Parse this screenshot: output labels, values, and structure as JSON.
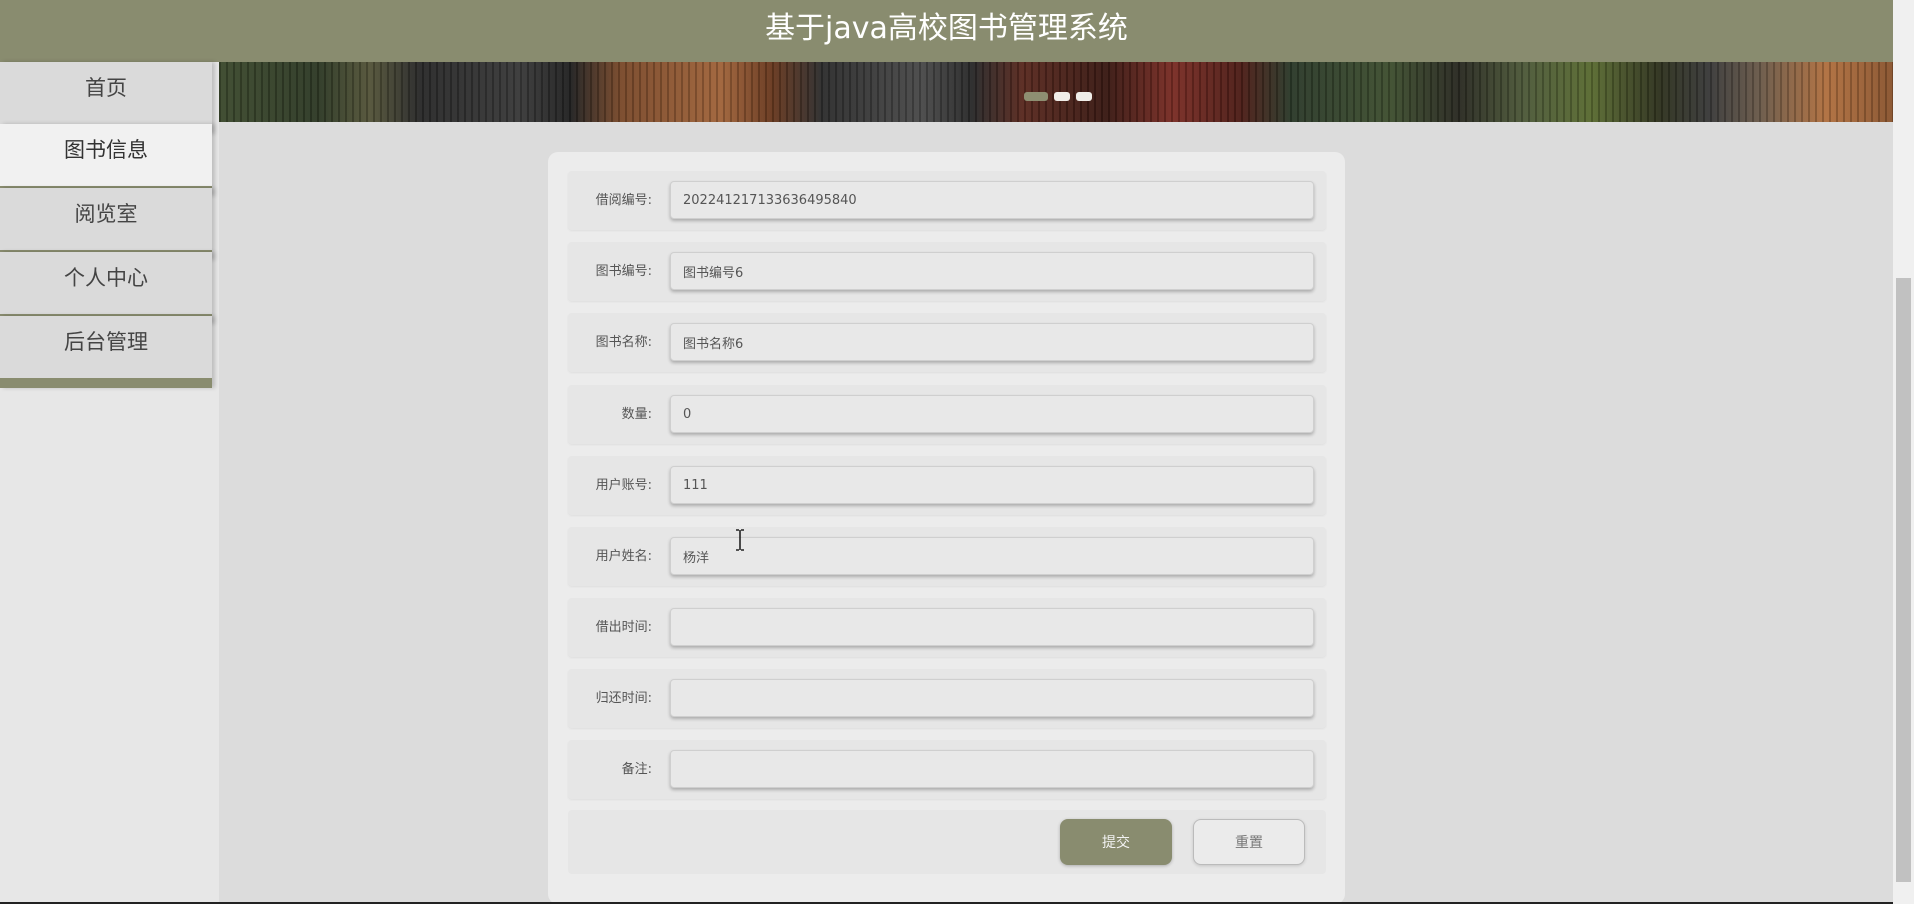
{
  "header": {
    "title": "基于java高校图书管理系统"
  },
  "nav": {
    "items": [
      {
        "label": "首页",
        "active": false
      },
      {
        "label": "图书信息",
        "active": true
      },
      {
        "label": "阅览室",
        "active": false
      },
      {
        "label": "个人中心",
        "active": false
      },
      {
        "label": "后台管理",
        "active": false
      }
    ]
  },
  "banner": {
    "slides": 3,
    "active_slide": 1
  },
  "form": {
    "fields": [
      {
        "label": "借阅编号:",
        "value": "20224121713363649584​0",
        "placeholder": ""
      },
      {
        "label": "图书编号:",
        "value": "图书编号6",
        "placeholder": ""
      },
      {
        "label": "图书名称:",
        "value": "图书名称6",
        "placeholder": ""
      },
      {
        "label": "数量:",
        "value": "0",
        "placeholder": ""
      },
      {
        "label": "用户账号:",
        "value": "111",
        "placeholder": ""
      },
      {
        "label": "用户姓名:",
        "value": "杨洋",
        "placeholder": ""
      },
      {
        "label": "借出时间:",
        "value": "",
        "placeholder": ""
      },
      {
        "label": "归还时间:",
        "value": "",
        "placeholder": ""
      },
      {
        "label": "备注:",
        "value": "",
        "placeholder": ""
      }
    ],
    "submit_label": "提交",
    "reset_label": "重置"
  },
  "colors": {
    "accent": "#898c6f",
    "background": "#dcdcdc"
  }
}
